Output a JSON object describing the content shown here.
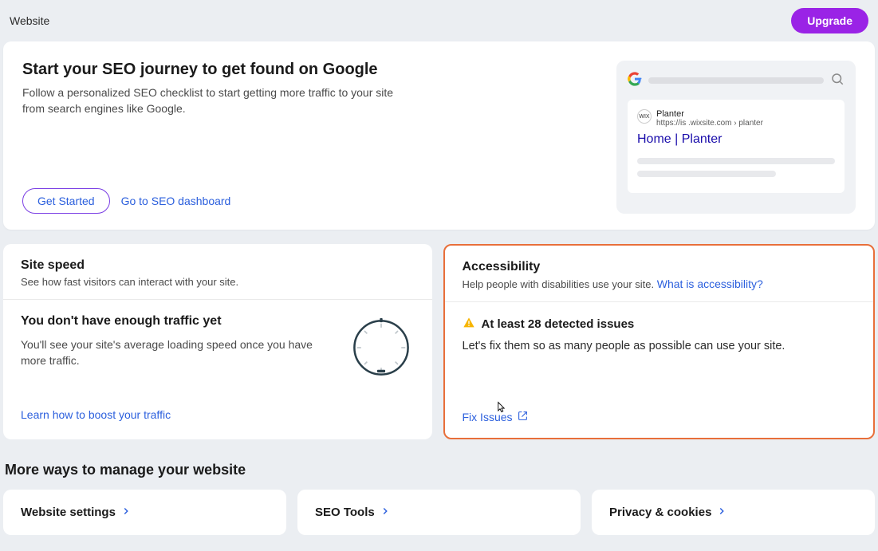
{
  "topbar": {
    "title": "Website",
    "upgrade_label": "Upgrade"
  },
  "seo_card": {
    "title": "Start your SEO journey to get found on Google",
    "description": "Follow a personalized SEO checklist to start getting more traffic to your site from search engines like Google.",
    "get_started_label": "Get Started",
    "dashboard_link": "Go to SEO dashboard",
    "preview": {
      "favicon_text": "WIX",
      "site_name": "Planter",
      "site_url": "https://is            .wixsite.com › planter",
      "result_title": "Home | Planter"
    }
  },
  "site_speed": {
    "title": "Site speed",
    "subtitle": "See how fast visitors can interact with your site.",
    "heading": "You don't have enough traffic yet",
    "description": "You'll see your site's average loading speed once you have more traffic.",
    "link": "Learn how to boost your traffic"
  },
  "accessibility": {
    "title": "Accessibility",
    "subtitle_prefix": "Help people with disabilities use your site. ",
    "learn_link": "What is accessibility?",
    "issue_heading": "At least 28 detected issues",
    "issue_description": "Let's fix them so as many people as possible can use your site.",
    "fix_link": "Fix Issues"
  },
  "more_section": {
    "heading": "More ways to manage your website",
    "cards": [
      {
        "title": "Website settings"
      },
      {
        "title": "SEO Tools"
      },
      {
        "title": "Privacy & cookies"
      }
    ]
  }
}
